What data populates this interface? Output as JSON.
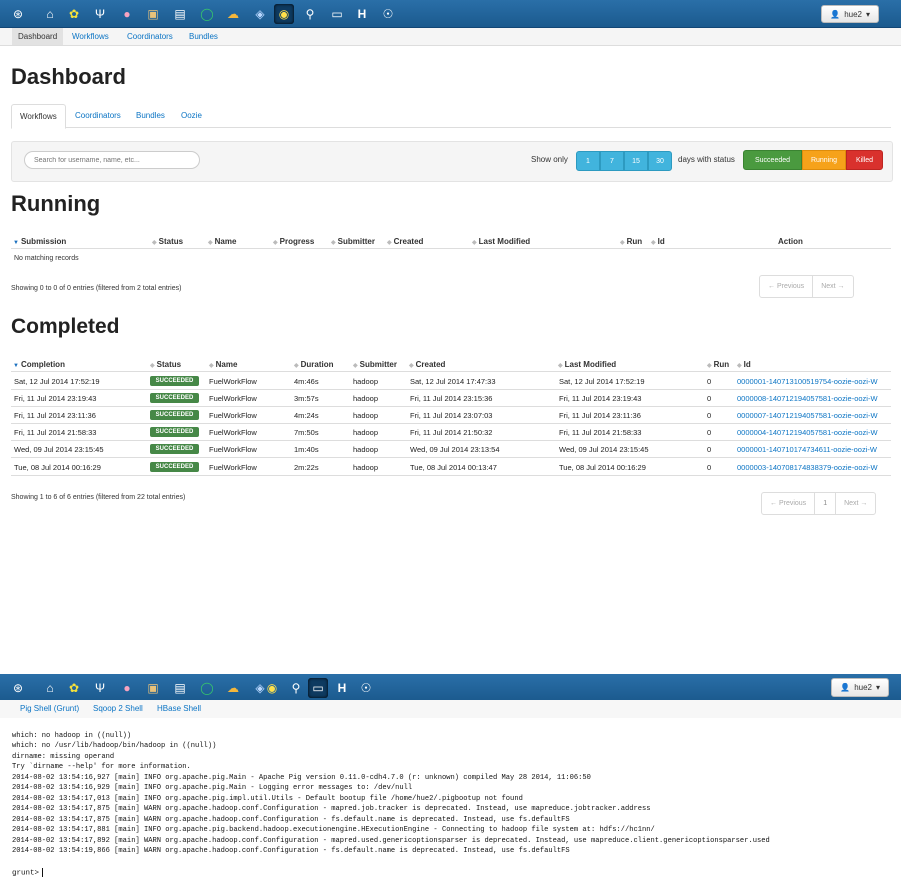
{
  "user": "hue2",
  "icons": [
    "hue-logo-icon",
    "home-icon",
    "beeswax-icon",
    "tuning-fork-icon",
    "pig-icon",
    "sqoop-icon",
    "file-browser-icon",
    "job-designer-icon",
    "oozie-icon",
    "hbase-icon",
    "security-icon",
    "search-icon",
    "shell-icon",
    "hadoop-h-icon",
    "help-icon"
  ],
  "subnav": {
    "dashboard": "Dashboard",
    "workflows": "Workflows",
    "coordinators": "Coordinators",
    "bundles": "Bundles"
  },
  "page_title": "Dashboard",
  "tabs": {
    "workflows": "Workflows",
    "coordinators": "Coordinators",
    "bundles": "Bundles",
    "oozie": "Oozie"
  },
  "filter": {
    "search_placeholder": "Search for username, name, etc...",
    "show_only": "Show only",
    "days": [
      "1",
      "7",
      "15",
      "30"
    ],
    "days_label": "days with status",
    "statuses": {
      "succeeded": "Succeeded",
      "running": "Running",
      "killed": "Killed"
    }
  },
  "running": {
    "title": "Running",
    "columns": [
      "Submission",
      "Status",
      "Name",
      "Progress",
      "Submitter",
      "Created",
      "Last Modified",
      "Run",
      "Id",
      "Action"
    ],
    "empty": "No matching records",
    "info": "Showing 0 to 0 of 0 entries (filtered from 2 total entries)",
    "prev": "← Previous",
    "next": "Next →"
  },
  "completed": {
    "title": "Completed",
    "columns": [
      "Completion",
      "Status",
      "Name",
      "Duration",
      "Submitter",
      "Created",
      "Last Modified",
      "Run",
      "Id"
    ],
    "rows": [
      {
        "completion": "Sat, 12 Jul 2014 17:52:19",
        "status": "SUCCEEDED",
        "name": "FuelWorkFlow",
        "duration": "4m:46s",
        "submitter": "hadoop",
        "created": "Sat, 12 Jul 2014 17:47:33",
        "modified": "Sat, 12 Jul 2014 17:52:19",
        "run": "0",
        "id": "0000001-140713100519754-oozie-oozi-W"
      },
      {
        "completion": "Fri, 11 Jul 2014 23:19:43",
        "status": "SUCCEEDED",
        "name": "FuelWorkFlow",
        "duration": "3m:57s",
        "submitter": "hadoop",
        "created": "Fri, 11 Jul 2014 23:15:36",
        "modified": "Fri, 11 Jul 2014 23:19:43",
        "run": "0",
        "id": "0000008-140712194057581-oozie-oozi-W"
      },
      {
        "completion": "Fri, 11 Jul 2014 23:11:36",
        "status": "SUCCEEDED",
        "name": "FuelWorkFlow",
        "duration": "4m:24s",
        "submitter": "hadoop",
        "created": "Fri, 11 Jul 2014 23:07:03",
        "modified": "Fri, 11 Jul 2014 23:11:36",
        "run": "0",
        "id": "0000007-140712194057581-oozie-oozi-W"
      },
      {
        "completion": "Fri, 11 Jul 2014 21:58:33",
        "status": "SUCCEEDED",
        "name": "FuelWorkFlow",
        "duration": "7m:50s",
        "submitter": "hadoop",
        "created": "Fri, 11 Jul 2014 21:50:32",
        "modified": "Fri, 11 Jul 2014 21:58:33",
        "run": "0",
        "id": "0000004-140712194057581-oozie-oozi-W"
      },
      {
        "completion": "Wed, 09 Jul 2014 23:15:45",
        "status": "SUCCEEDED",
        "name": "FuelWorkFlow",
        "duration": "1m:40s",
        "submitter": "hadoop",
        "created": "Wed, 09 Jul 2014 23:13:54",
        "modified": "Wed, 09 Jul 2014 23:15:45",
        "run": "0",
        "id": "0000001-140710174734611-oozie-oozi-W"
      },
      {
        "completion": "Tue, 08 Jul 2014 00:16:29",
        "status": "SUCCEEDED",
        "name": "FuelWorkFlow",
        "duration": "2m:22s",
        "submitter": "hadoop",
        "created": "Tue, 08 Jul 2014 00:13:47",
        "modified": "Tue, 08 Jul 2014 00:16:29",
        "run": "0",
        "id": "0000003-140708174838379-oozie-oozi-W"
      }
    ],
    "info": "Showing 1 to 6 of 6 entries (filtered from 22 total entries)",
    "prev": "← Previous",
    "page": "1",
    "next": "Next →"
  },
  "shell_tabs": {
    "pig": "Pig Shell (Grunt)",
    "sqoop": "Sqoop 2 Shell",
    "hbase": "HBase Shell"
  },
  "console_lines": [
    "which: no hadoop in ((null))",
    "which: no /usr/lib/hadoop/bin/hadoop in ((null))",
    "dirname: missing operand",
    "Try `dirname --help' for more information.",
    "2014-08-02 13:54:16,927 [main] INFO org.apache.pig.Main - Apache Pig version 0.11.0-cdh4.7.0 (r: unknown) compiled May 28 2014, 11:06:50",
    "2014-08-02 13:54:16,929 [main] INFO org.apache.pig.Main - Logging error messages to: /dev/null",
    "2014-08-02 13:54:17,013 [main] INFO org.apache.pig.impl.util.Utils - Default bootup file /home/hue2/.pigbootup not found",
    "2014-08-02 13:54:17,875 [main] WARN org.apache.hadoop.conf.Configuration - mapred.job.tracker is deprecated. Instead, use mapreduce.jobtracker.address",
    "2014-08-02 13:54:17,875 [main] WARN org.apache.hadoop.conf.Configuration - fs.default.name is deprecated. Instead, use fs.defaultFS",
    "2014-08-02 13:54:17,881 [main] INFO org.apache.pig.backend.hadoop.executionengine.HExecutionEngine - Connecting to hadoop file system at: hdfs://hc1nn/",
    "2014-08-02 13:54:17,892 [main] WARN org.apache.hadoop.conf.Configuration - mapred.used.genericoptionsparser is deprecated. Instead, use mapreduce.client.genericoptionsparser.used",
    "2014-08-02 13:54:19,866 [main] WARN org.apache.hadoop.conf.Configuration - fs.default.name is deprecated. Instead, use fs.defaultFS"
  ],
  "prompt": "grunt>"
}
